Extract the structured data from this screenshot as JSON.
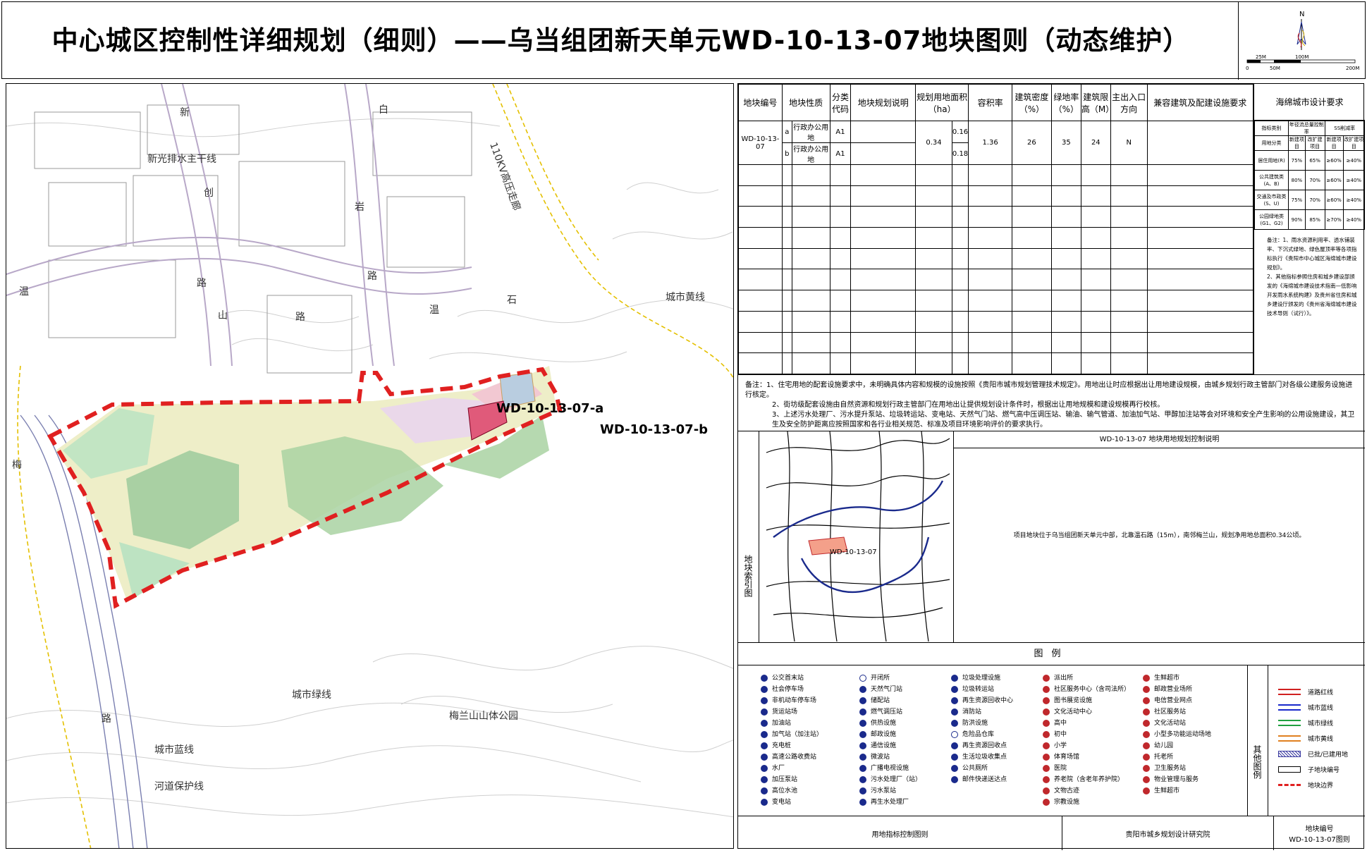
{
  "title": "中心城区控制性详细规划（细则）——乌当组团新天单元WD-10-13-07地块图则（动态维护）",
  "compass": {
    "north": "N",
    "scale_labels": [
      "0",
      "25M",
      "50M",
      "100M",
      "200M"
    ]
  },
  "map": {
    "labels": {
      "main_trunk": "新光排水主干线",
      "road_xin": "新",
      "road_bai": "白",
      "road_chuang": "创",
      "road_yan": "岩",
      "road_lu1": "路",
      "road_lu2": "路",
      "road_lu3": "路",
      "road_lu4": "路",
      "road_wen": "温",
      "road_wen2": "温",
      "road_shan": "山",
      "road_shi": "石",
      "road_mei": "梅",
      "power_corridor": "110KV高压走廊",
      "yellow_line": "城市黄线",
      "plot_a": "WD-10-13-07-a",
      "plot_b": "WD-10-13-07-b",
      "green_line": "城市绿线",
      "park": "梅兰山山体公园",
      "blue_line": "城市蓝线",
      "river": "河道保护线"
    }
  },
  "table": {
    "headers": [
      "地块编号",
      "地块性质",
      "分类代码",
      "地块规划说明",
      "规划用地面积（ha）",
      "容积率",
      "建筑密度（%）",
      "绿地率（%）",
      "建筑限高（M）",
      "主出入口方向",
      "兼容建筑及配建设施要求"
    ],
    "plot_id": "WD-10-13-07",
    "rows": [
      {
        "sub": "a",
        "nature": "行政办公用地",
        "code": "A1",
        "sub_area": "0.16"
      },
      {
        "sub": "b",
        "nature": "行政办公用地",
        "code": "A1",
        "sub_area": "0.18"
      }
    ],
    "area": "0.34",
    "far": "1.36",
    "density": "26",
    "green": "35",
    "height": "24",
    "entrance": "N"
  },
  "sponge": {
    "title": "海绵城市设计要求",
    "head1": [
      "指标类别",
      "年径流总量控制率",
      "SS削减率"
    ],
    "head2": [
      "用地分类",
      "新建项目",
      "改扩建项目",
      "新建项目",
      "改扩建项目"
    ],
    "rows": [
      [
        "居住用地(R)",
        "75%",
        "65%",
        "≥60%",
        "≥40%"
      ],
      [
        "公共建筑类(A、B)",
        "80%",
        "70%",
        "≥60%",
        "≥40%"
      ],
      [
        "交通及市政类(S、U)",
        "75%",
        "70%",
        "≥60%",
        "≥40%"
      ],
      [
        "公园绿地类(G1、G2)",
        "90%",
        "85%",
        "≥70%",
        "≥40%"
      ]
    ],
    "note1": "备注：1、雨水资源利用率、透水铺装率、下沉式绿地、绿色屋顶率等各项指标执行《贵阳市中心城区海绵城市建设规划》。",
    "note2": "2、其他指标参照住房和城乡建设部颁发的《海绵城市建设技术指南—低影响开发雨水系统构建》及贵州省住房和城乡建设厅颁发的《贵州省海绵城市建设技术导则（试行）》。"
  },
  "notes": [
    "备注：1、住宅用地的配套设施要求中，未明确具体内容和规模的设施按照《贵阳市城市规划管理技术规定》。用地出让时应根据出让用地建设规模，由城乡规划行政主管部门对各级公建服务设施进行核定。",
    "2、街坊级配套设施由自然资源和规划行政主管部门在用地出让提供规划设计条件时，根据出让用地规模和建设规模再行校核。",
    "3、上述污水处理厂、污水提升泵站、垃圾转运站、变电站、天然气门站、燃气高中压调压站、输油、输气管道、加油加气站、甲醇加注站等会对环境和安全产生影响的公用设施建设，其卫生及安全防护距离应按照国家和各行业相关规范、标准及项目环境影响评价的要求执行。"
  ],
  "index": {
    "label": "地块索引图",
    "map_label": "WD-10-13-07",
    "title": "WD-10-13-07 地块用地规划控制说明",
    "desc": "项目地块位于乌当组团新天单元中部，北靠温石路（15m），南邻梅兰山，规划净用地总面积0.34公顷。"
  },
  "legend": {
    "title": "图例",
    "col1": [
      "公交首末站",
      "社会停车场",
      "非机动车停车场",
      "货运站场",
      "加油站",
      "加气站（加注站）",
      "充电桩",
      "高速公路收费站",
      "水厂",
      "加压泵站",
      "高位水池",
      "变电站"
    ],
    "col2": [
      "开闭所",
      "天然气门站",
      "储配站",
      "燃气调压站",
      "供热设施",
      "邮政设施",
      "通信设施",
      "微波站",
      "广播电视设施",
      "污水处理厂（站）",
      "污水泵站",
      "再生水处理厂"
    ],
    "col3": [
      "垃圾处理设施",
      "垃圾转运站",
      "再生资源回收中心",
      "消防站",
      "防洪设施",
      "危险品仓库",
      "再生资源回收点",
      "生活垃圾收集点",
      "公共厕所",
      "邮件快递送达点"
    ],
    "col4": [
      "派出所",
      "社区服务中心（含司法所）",
      "图书展览设施",
      "文化活动中心",
      "高中",
      "初中",
      "小学",
      "体育场馆",
      "医院",
      "养老院（含老年养护院）",
      "文物古迹",
      "宗教设施"
    ],
    "col5": [
      "生鲜超市",
      "邮政营业场所",
      "电信营业网点",
      "社区服务站",
      "文化活动站",
      "小型多功能运动场地",
      "幼儿园",
      "托老所",
      "卫生服务站",
      "物业管理与服务",
      "生鲜超市"
    ],
    "other_label": "其他图例",
    "other": [
      "道路红线",
      "城市蓝线",
      "城市绿线",
      "城市黄线",
      "已批/已建用地",
      "子地块编号",
      "地块边界"
    ]
  },
  "footer": {
    "left": "用地指标控制图则",
    "mid": "贵阳市城乡规划设计研究院",
    "right1": "地块编号",
    "right2": "WD-10-13-07图则"
  }
}
